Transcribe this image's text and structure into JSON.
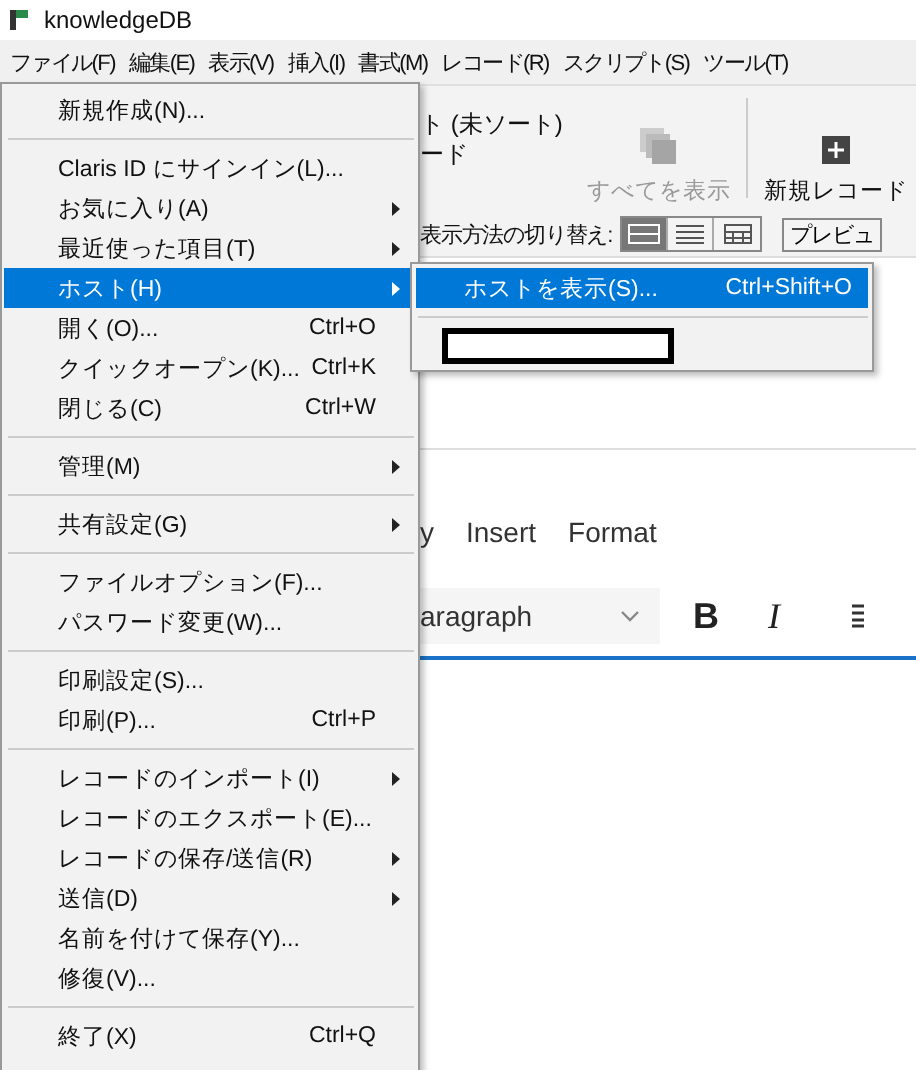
{
  "window": {
    "title": "knowledgeDB"
  },
  "menubar": [
    "ファイル(F)",
    "編集(E)",
    "表示(V)",
    "挿入(I)",
    "書式(M)",
    "レコード(R)",
    "スクリプト(S)",
    "ツール(T)"
  ],
  "toolbar": {
    "sort_status": "ト (未ソート)",
    "record_label": "ード",
    "show_all": {
      "label": "すべてを表示",
      "disabled": true
    },
    "new_record": {
      "label": "新規レコード",
      "disabled": false
    }
  },
  "view_switch": {
    "label": "表示方法の切り替え:",
    "modes": [
      {
        "kind": "form",
        "selected": true
      },
      {
        "kind": "list",
        "selected": false
      },
      {
        "kind": "table",
        "selected": false
      }
    ],
    "preview": "プレビュ"
  },
  "editor": {
    "menu": [
      "y",
      "Insert",
      "Format"
    ],
    "block_style": "aragraph",
    "bold": "B",
    "italic": "I"
  },
  "file_menu": [
    [
      {
        "label": "新規作成(N)...",
        "submenu": false,
        "selected": false
      }
    ],
    [
      {
        "label": "Claris ID にサインイン(L)...",
        "submenu": false,
        "selected": false
      },
      {
        "label": "お気に入り(A)",
        "submenu": true,
        "selected": false
      },
      {
        "label": "最近使った項目(T)",
        "submenu": true,
        "selected": false
      },
      {
        "label": "ホスト(H)",
        "submenu": true,
        "selected": true
      },
      {
        "label": "開く(O)...",
        "shortcut": "Ctrl+O",
        "submenu": false,
        "selected": false
      },
      {
        "label": "クイックオープン(K)...",
        "shortcut": "Ctrl+K",
        "submenu": false,
        "selected": false
      },
      {
        "label": "閉じる(C)",
        "shortcut": "Ctrl+W",
        "submenu": false,
        "selected": false
      }
    ],
    [
      {
        "label": "管理(M)",
        "submenu": true,
        "selected": false
      }
    ],
    [
      {
        "label": "共有設定(G)",
        "submenu": true,
        "selected": false
      }
    ],
    [
      {
        "label": "ファイルオプション(F)...",
        "submenu": false,
        "selected": false
      },
      {
        "label": "パスワード変更(W)...",
        "submenu": false,
        "selected": false
      }
    ],
    [
      {
        "label": "印刷設定(S)...",
        "submenu": false,
        "selected": false
      },
      {
        "label": "印刷(P)...",
        "shortcut": "Ctrl+P",
        "submenu": false,
        "selected": false
      }
    ],
    [
      {
        "label": "レコードのインポート(I)",
        "submenu": true,
        "selected": false
      },
      {
        "label": "レコードのエクスポート(E)...",
        "submenu": false,
        "selected": false
      },
      {
        "label": "レコードの保存/送信(R)",
        "submenu": true,
        "selected": false
      },
      {
        "label": "送信(D)",
        "submenu": true,
        "selected": false
      },
      {
        "label": "名前を付けて保存(Y)...",
        "submenu": false,
        "selected": false
      },
      {
        "label": "修復(V)...",
        "submenu": false,
        "selected": false
      }
    ],
    [
      {
        "label": "終了(X)",
        "shortcut": "Ctrl+Q",
        "submenu": false,
        "selected": false
      }
    ]
  ],
  "host_submenu": [
    [
      {
        "kind": "item",
        "label": "ホストを表示(S)...",
        "shortcut": "Ctrl+Shift+O",
        "selected": true
      }
    ],
    [
      {
        "kind": "redacted",
        "selected": false
      }
    ]
  ]
}
